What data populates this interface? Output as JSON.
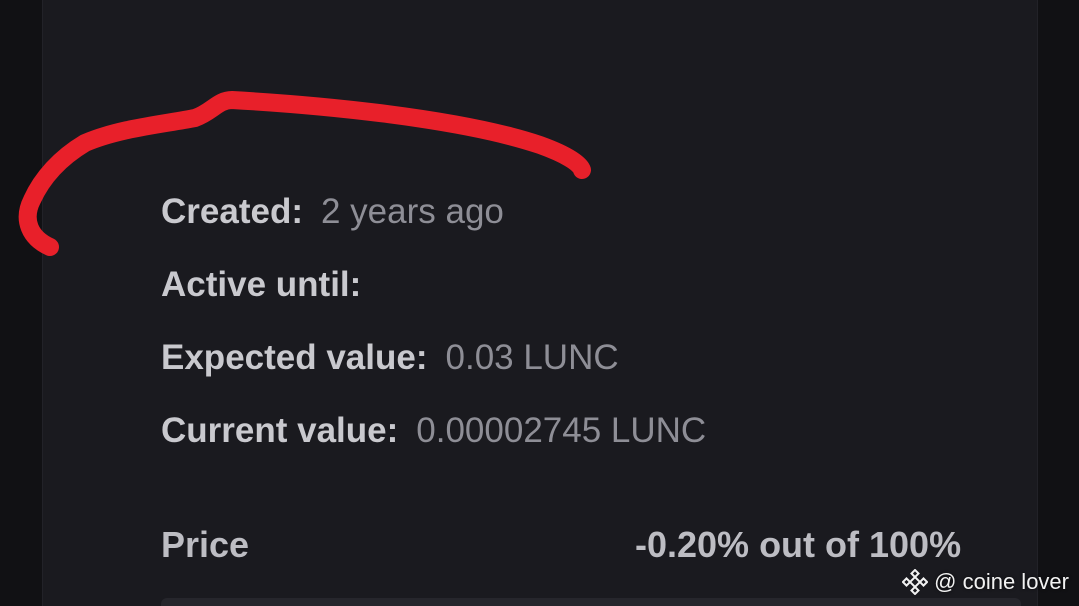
{
  "details": {
    "created": {
      "label": "Created:",
      "value": "2 years ago"
    },
    "active_until": {
      "label": "Active until:",
      "value": ""
    },
    "expected_value": {
      "label": "Expected value:",
      "value": "0.03 LUNC"
    },
    "current_value": {
      "label": "Current value:",
      "value": "0.00002745 LUNC"
    }
  },
  "price": {
    "label": "Price",
    "value": "-0.20% out of 100%"
  },
  "annotation": {
    "color": "#e8202a"
  },
  "watermark": {
    "icon": "binance-logo-icon",
    "text": "@ coine lover"
  }
}
